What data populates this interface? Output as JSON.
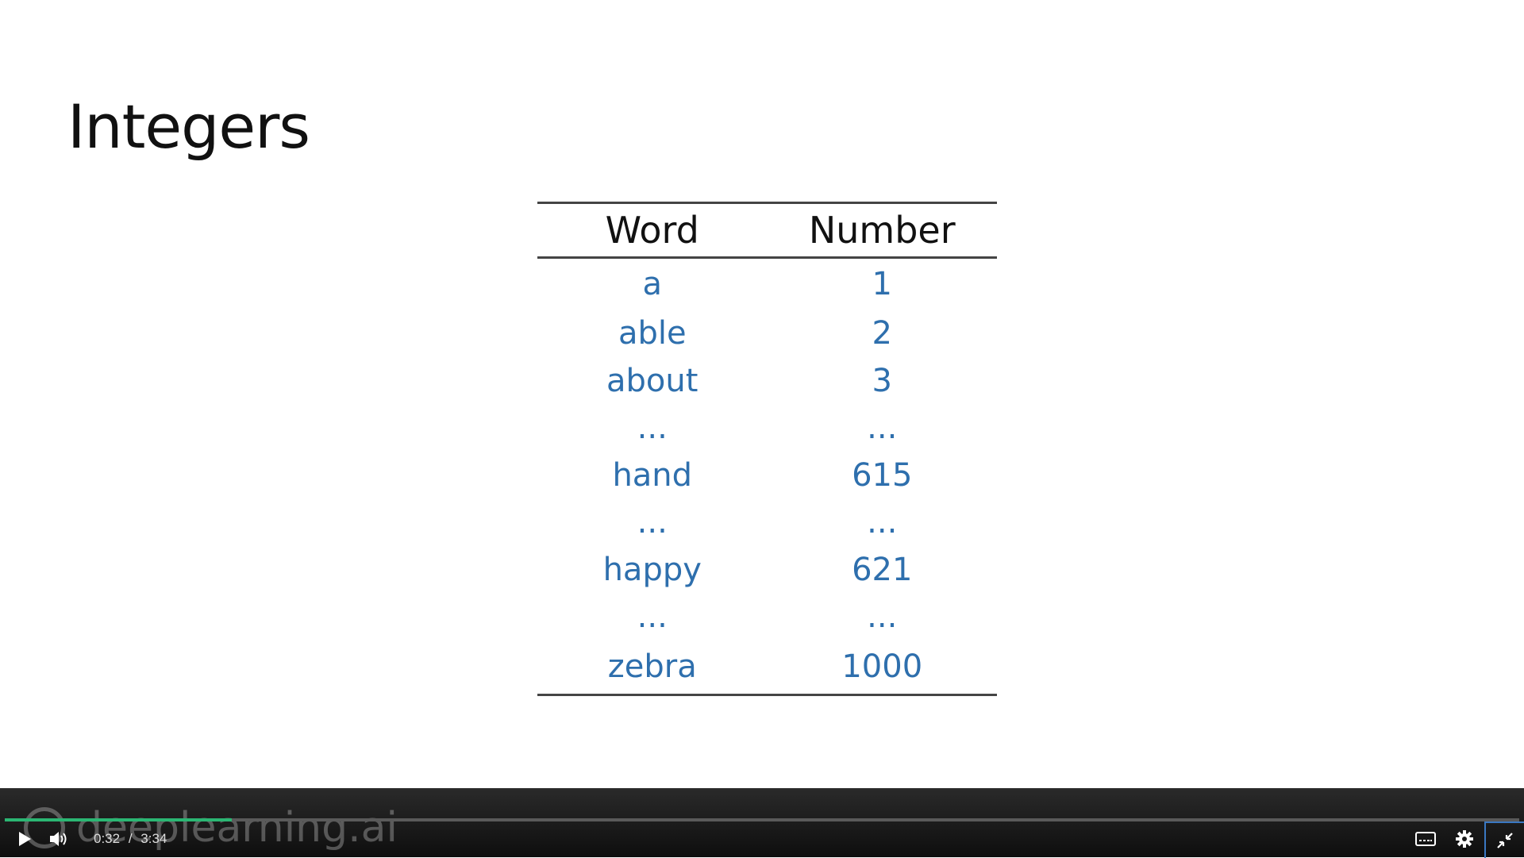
{
  "slide": {
    "title": "Integers",
    "table": {
      "headers": [
        "Word",
        "Number"
      ],
      "rows": [
        [
          "a",
          "1"
        ],
        [
          "able",
          "2"
        ],
        [
          "about",
          "3"
        ],
        [
          "...",
          "..."
        ],
        [
          "hand",
          "615"
        ],
        [
          "...",
          "..."
        ],
        [
          "happy",
          "621"
        ],
        [
          "...",
          "..."
        ],
        [
          "zebra",
          "1000"
        ]
      ]
    },
    "colors": {
      "header_text": "#111111",
      "cell_text": "#2e6fad"
    }
  },
  "player": {
    "current_time": "0:32",
    "separator": "/",
    "duration": "3:34",
    "progress_fraction": 0.15,
    "watermark": "deeplearning.ai",
    "accent_color": "#2bb673",
    "icons": [
      "play-icon",
      "volume-icon",
      "captions-icon",
      "settings-icon",
      "exit-fullscreen-icon"
    ]
  }
}
